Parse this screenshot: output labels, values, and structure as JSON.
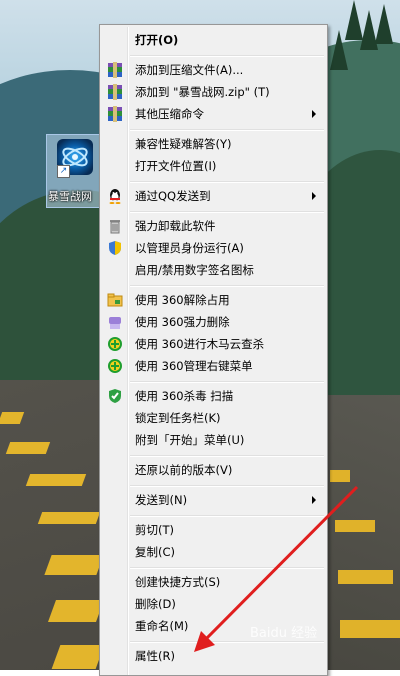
{
  "desktop_icon": {
    "label": "暴雪战网"
  },
  "menu": {
    "items": [
      {
        "label": "打开(O)",
        "icon": "none"
      },
      {
        "label": "添加到压缩文件(A)...",
        "icon": "archive-icon"
      },
      {
        "label": "添加到 \"暴雪战网.zip\" (T)",
        "icon": "archive-icon"
      },
      {
        "label": "其他压缩命令",
        "icon": "archive-icon"
      },
      {
        "label": "兼容性疑难解答(Y)",
        "icon": "none"
      },
      {
        "label": "打开文件位置(I)",
        "icon": "none"
      },
      {
        "label": "通过QQ发送到",
        "icon": "qq-icon"
      },
      {
        "label": "强力卸载此软件",
        "icon": "trash-icon"
      },
      {
        "label": "以管理员身份运行(A)",
        "icon": "uac-shield-icon"
      },
      {
        "label": "启用/禁用数字签名图标",
        "icon": "none"
      },
      {
        "label": "使用 360解除占用",
        "icon": "folder-lock-icon"
      },
      {
        "label": "使用 360强力删除",
        "icon": "shredder-icon"
      },
      {
        "label": "使用 360进行木马云查杀",
        "icon": "360-plus-icon"
      },
      {
        "label": "使用 360管理右键菜单",
        "icon": "360-plus-icon"
      },
      {
        "label": "使用 360杀毒 扫描",
        "icon": "360-shield-icon"
      },
      {
        "label": "锁定到任务栏(K)",
        "icon": "none"
      },
      {
        "label": "附到「开始」菜单(U)",
        "icon": "none"
      },
      {
        "label": "还原以前的版本(V)",
        "icon": "none"
      },
      {
        "label": "发送到(N)",
        "icon": "none"
      },
      {
        "label": "剪切(T)",
        "icon": "none"
      },
      {
        "label": "复制(C)",
        "icon": "none"
      },
      {
        "label": "创建快捷方式(S)",
        "icon": "none"
      },
      {
        "label": "删除(D)",
        "icon": "none"
      },
      {
        "label": "重命名(M)",
        "icon": "none"
      },
      {
        "label": "属性(R)",
        "icon": "none"
      }
    ]
  },
  "watermark": {
    "text": "Baidu 经验"
  },
  "colors": {
    "arrow": "#e01e1e",
    "menu_bg": "#f0f0f0",
    "stripe": "#e3b52c"
  }
}
